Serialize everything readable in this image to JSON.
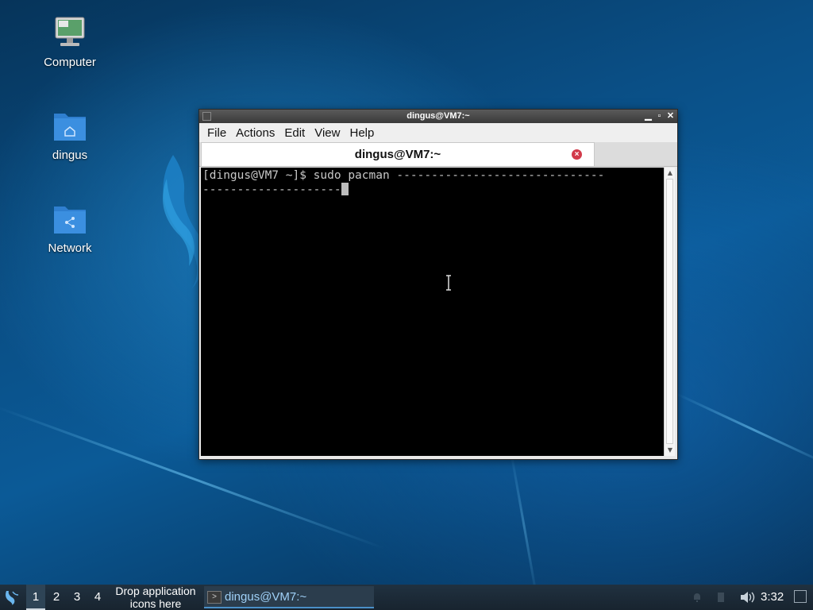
{
  "desktop": {
    "icons": [
      {
        "label": "Computer"
      },
      {
        "label": "dingus"
      },
      {
        "label": "Network"
      }
    ]
  },
  "window": {
    "title": "dingus@VM7:~",
    "controls": [
      "minimize",
      "maximize",
      "close"
    ],
    "menu": [
      "File",
      "Actions",
      "Edit",
      "View",
      "Help"
    ],
    "tab_title": "dingus@VM7:~",
    "terminal_lines": [
      "[dingus@VM7 ~]$ sudo pacman ------------------------------",
      "--------------------"
    ]
  },
  "taskbar": {
    "workspaces": [
      "1",
      "2",
      "3",
      "4"
    ],
    "active_workspace": "1",
    "drop_line1": "Drop application",
    "drop_line2": "icons here",
    "task_label": "dingus@VM7:~",
    "clock": "3:32"
  },
  "colors": {
    "accent": "#4a90c8",
    "close_tab": "#d23a4a",
    "terminal_bg": "#000000",
    "terminal_fg": "#c8c8c8"
  }
}
